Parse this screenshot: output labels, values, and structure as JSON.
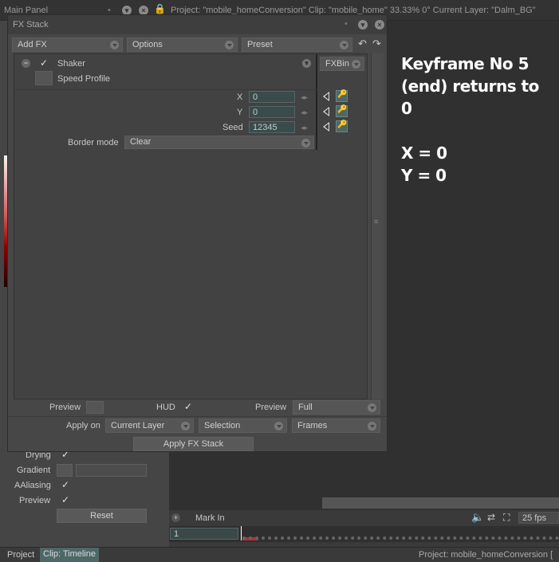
{
  "topbar": {
    "main_panel": "Main Panel",
    "project": "Project:  \"mobile_homeConversion\"  Clip: \"mobile_home\"   33.33%   0°   Current Layer: \"Dalm_BG\""
  },
  "fx_window": {
    "title": "FX Stack",
    "toolbar": {
      "add_fx": "Add FX",
      "options": "Options",
      "preset": "Preset"
    },
    "effect": {
      "name": "Shaker",
      "sub": "Speed Profile",
      "fxbin": "FXBin",
      "params": [
        {
          "label": "X",
          "value": "0"
        },
        {
          "label": "Y",
          "value": "0"
        },
        {
          "label": "Seed",
          "value": "12345"
        }
      ],
      "border_mode_label": "Border mode",
      "border_mode_value": "Clear"
    },
    "bottom": {
      "preview_label": "Preview",
      "hud_label": "HUD",
      "preview2_label": "Preview",
      "preview2_value": "Full",
      "apply_on_label": "Apply on",
      "apply_on_value": "Current Layer",
      "selection_value": "Selection",
      "frames_value": "Frames",
      "apply_button": "Apply FX Stack"
    }
  },
  "annotation": "Keyframe No 5\n(end) returns to\n0\n\nX = 0\nY = 0",
  "left_panel": {
    "drying": "Drying",
    "gradient": "Gradient",
    "aaliasing": "AAliasing",
    "preview": "Preview",
    "reset": "Reset"
  },
  "timeline": {
    "mark_in": "Mark In",
    "frame": "1",
    "fps": "25 fps"
  },
  "bottom_tabs": {
    "project": "Project",
    "clip": "Clip: Timeline",
    "status": "Project: mobile_homeConversion ["
  }
}
